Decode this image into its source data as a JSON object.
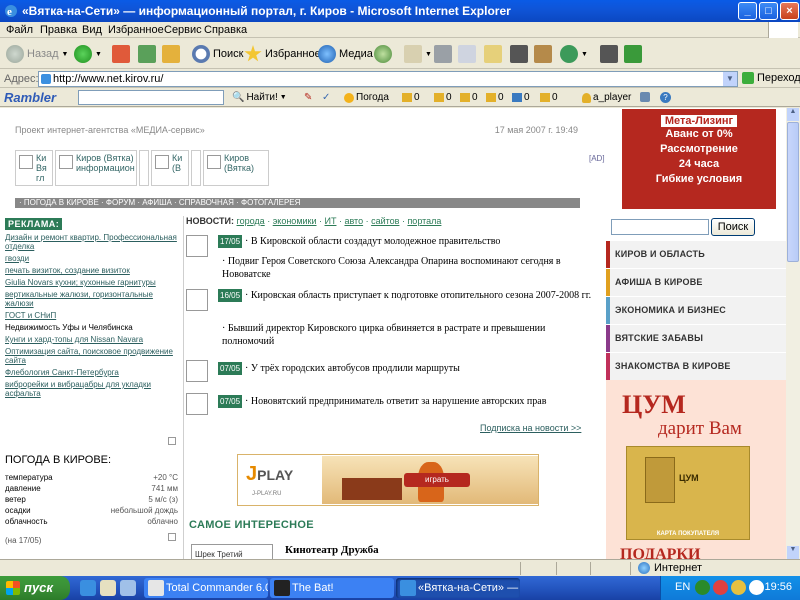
{
  "window": {
    "title": "«Вятка-на-Сети» — информационный портал, г. Киров - Microsoft Internet Explorer",
    "btn_min": "_",
    "btn_max": "□",
    "btn_close": "×"
  },
  "menubar": {
    "items": [
      "Файл",
      "Правка",
      "Вид",
      "Избранное",
      "Сервис",
      "Справка"
    ]
  },
  "toolbar": {
    "back": "Назад",
    "search": "Поиск",
    "favorites": "Избранное",
    "media": "Медиа"
  },
  "address": {
    "label": "Адрес:",
    "url": "http://www.net.kirov.ru/",
    "go": "Переход"
  },
  "rambler": {
    "logo": "Rambler",
    "find": "Найти!",
    "weather": "Погода",
    "counters": [
      "0",
      "0",
      "0",
      "0",
      "0",
      "0"
    ],
    "player": "a_player"
  },
  "page": {
    "header_left": "Проект интернет-агентства «МЕДИА-сервис»",
    "header_date": "17 мая 2007 г. 19:49",
    "logo_tabs": [
      "Ки Вя гл",
      "Киров (Вятка) информацион",
      "Ки (В",
      "Киров (Вятка)"
    ],
    "ad_marker": "[AD]",
    "nav_line": "· ПОГОДА В КИРОВЕ · ФОРУМ · АФИША · СПРАВОЧНАЯ · ФОТОГАЛЕРЕЯ",
    "meta_banner": {
      "line1": "Мета-Лизинг",
      "line2": "Аванс от 0%",
      "line3": "Рассмотрение",
      "line4": "24 часа",
      "line5": "Гибкие условия"
    }
  },
  "left": {
    "ads_title": "РЕКЛАМА:",
    "ads": [
      {
        "text": "Дизайн и ремонт квартир. Профессиональная отделка",
        "link": true
      },
      {
        "text": "гвозди",
        "link": true
      },
      {
        "text": "печать визиток, создание визиток",
        "link": true
      },
      {
        "text": "Giulia Novars кухни; кухонные гарнитуры",
        "link": true
      },
      {
        "text": "вертикальные жалюзи, горизонтальные жалюзи",
        "link": true
      },
      {
        "text": "ГОСТ и СНиП",
        "link": true
      },
      {
        "text": "Недвижимость Уфы и Челябинска",
        "link": false
      },
      {
        "text": "Кунги и хард-топы для Nissan Navara",
        "link": true
      },
      {
        "text": "Оптимизация сайта, поисковое продвижение сайта",
        "link": true
      },
      {
        "text": "Флебология Санкт-Петербурга",
        "link": true
      },
      {
        "text": "виброрейки и вибрацабры для укладки асфальта",
        "link": true
      }
    ],
    "weather_title": "ПОГОДА В КИРОВЕ:",
    "weather": [
      {
        "label": "температура",
        "value": "+20 °C"
      },
      {
        "label": "давление",
        "value": "741 мм"
      },
      {
        "label": "ветер",
        "value": "5 м/с (з)"
      },
      {
        "label": "осадки",
        "value": "небольшой дождь"
      },
      {
        "label": "облачность",
        "value": "облачно"
      }
    ],
    "weather_date": "(на 17/05)"
  },
  "news": {
    "head_label": "НОВОСТИ:",
    "head_links": [
      "города",
      "экономики",
      "ИТ",
      "авто",
      "сайтов",
      "портала"
    ],
    "items": [
      {
        "date": "17/05",
        "text": "· В Кировской области создадут молодежное правительство",
        "sub": "· Подвиг Героя Советского Союза Александра Опарина воспоминают сегодня в Нововатске"
      },
      {
        "date": "16/05",
        "text": "· Кировская область приступает к подготовке отопительного сезона 2007-2008 гг.",
        "sub": "· Бывший директор Кировского цирка обвиняется в растрате и превышении полномочий"
      },
      {
        "date": "07/05",
        "text": "· У трёх городских автобусов продлили маршруты",
        "sub": ""
      },
      {
        "date": "07/05",
        "text": "· Нововятский предприниматель ответит за нарушение авторских прав",
        "sub": ""
      }
    ],
    "subscribe": "Подписка на новости >>",
    "banner_logo": "PLAY",
    "banner_logo_j": "J",
    "banner_site": "J-PLAY.RU",
    "banner_btn": "играть",
    "interesting_title": "САМОЕ ИНТЕРЕСНОЕ",
    "card_thumb": "Шрек Третий",
    "card_title": "Кинотеатр Дружба"
  },
  "right": {
    "search_btn": "Поиск",
    "menu": [
      {
        "label": "КИРОВ И ОБЛАСТЬ",
        "color": "#b5281f"
      },
      {
        "label": "АФИША В КИРОВЕ",
        "color": "#e0a020"
      },
      {
        "label": "ЭКОНОМИКА И БИЗНЕС",
        "color": "#5aa0c8"
      },
      {
        "label": "ВЯТСКИЕ ЗАБАВЫ",
        "color": "#8a3a8a"
      },
      {
        "label": "ЗНАКОМСТВА В КИРОВЕ",
        "color": "#c0305a"
      }
    ],
    "tsum": {
      "title": "ЦУМ",
      "subtitle": "дарит Вам",
      "card_logo": "ЦУМ",
      "card_caption": "КАРТА ПОКУПАТЕЛЯ",
      "bottom": "ПОДАРКИ"
    }
  },
  "status": {
    "zone": "Интернет"
  },
  "taskbar": {
    "start": "пуск",
    "tasks": [
      "Total Commander 6.0...",
      "The Bat!",
      "«Вятка-на-Сети» — ..."
    ],
    "lang": "EN",
    "clock": "19:56"
  }
}
